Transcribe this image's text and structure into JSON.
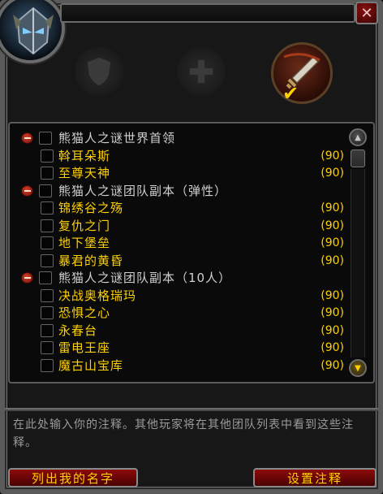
{
  "window": {
    "title": ""
  },
  "roles": [
    {
      "name": "tank",
      "selected": false
    },
    {
      "name": "healer",
      "selected": false
    },
    {
      "name": "damage",
      "selected": true
    }
  ],
  "activities": [
    {
      "type": "header",
      "label": "熊猫人之谜世界首领",
      "level": ""
    },
    {
      "type": "item",
      "label": "斡耳朵斯",
      "level": "(90)"
    },
    {
      "type": "item",
      "label": "至尊天神",
      "level": "(90)"
    },
    {
      "type": "header",
      "label": "熊猫人之谜团队副本（弹性）",
      "level": ""
    },
    {
      "type": "item",
      "label": "锦绣谷之殇",
      "level": "(90)"
    },
    {
      "type": "item",
      "label": "复仇之门",
      "level": "(90)"
    },
    {
      "type": "item",
      "label": "地下堡垒",
      "level": "(90)"
    },
    {
      "type": "item",
      "label": "暴君的黄昏",
      "level": "(90)"
    },
    {
      "type": "header",
      "label": "熊猫人之谜团队副本（10人）",
      "level": ""
    },
    {
      "type": "item",
      "label": "决战奥格瑞玛",
      "level": "(90)"
    },
    {
      "type": "item",
      "label": "恐惧之心",
      "level": "(90)"
    },
    {
      "type": "item",
      "label": "永春台",
      "level": "(90)"
    },
    {
      "type": "item",
      "label": "雷电王座",
      "level": "(90)"
    },
    {
      "type": "item",
      "label": "魔古山宝库",
      "level": "(90)"
    }
  ],
  "note": {
    "placeholder": "在此处输入你的注释。其他玩家将在其他团队列表中看到这些注释。"
  },
  "buttons": {
    "list_my_name": "列出我的名字",
    "set_note": "设置注释",
    "close": "✕"
  },
  "colors": {
    "accent_gold": "#ffd100",
    "header_text": "#cfcfcf",
    "button_red": "#8c0a0a"
  }
}
